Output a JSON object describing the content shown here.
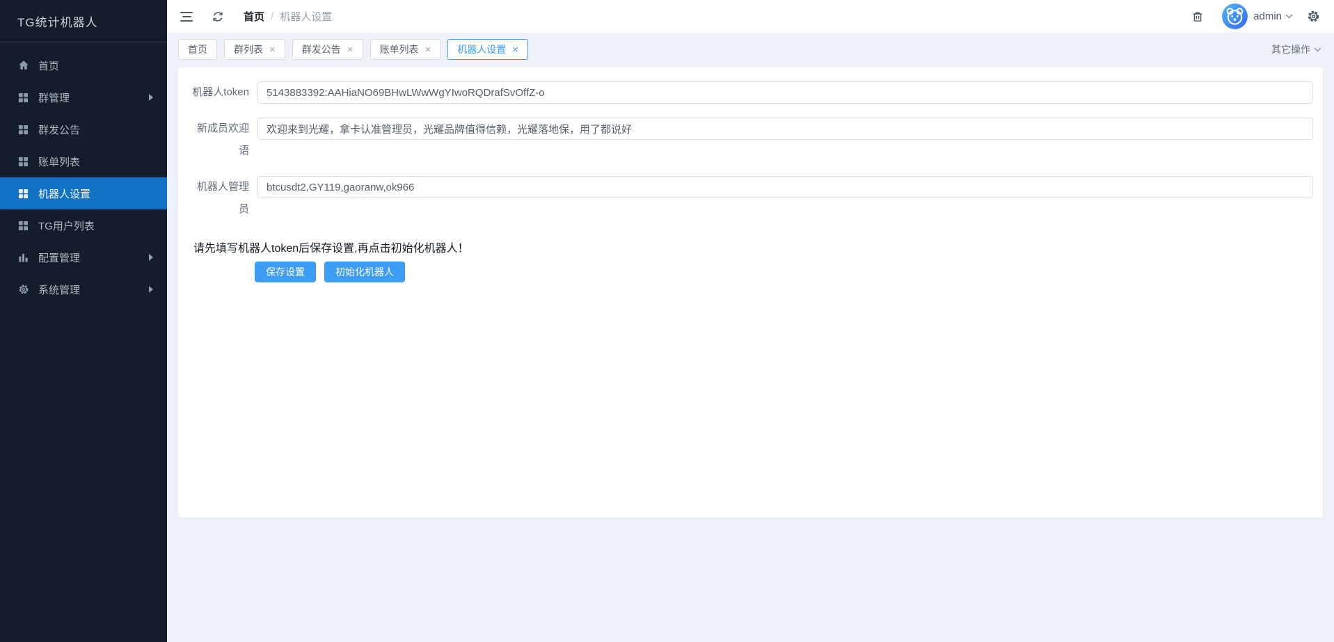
{
  "app": {
    "title": "TG统计机器人"
  },
  "sidebar": {
    "items": [
      {
        "label": "首页",
        "icon": "home-icon",
        "active": false,
        "has_submenu": false
      },
      {
        "label": "群管理",
        "icon": "grid-icon",
        "active": false,
        "has_submenu": true
      },
      {
        "label": "群发公告",
        "icon": "grid-icon",
        "active": false,
        "has_submenu": false
      },
      {
        "label": "账单列表",
        "icon": "grid-icon",
        "active": false,
        "has_submenu": false
      },
      {
        "label": "机器人设置",
        "icon": "grid-icon",
        "active": true,
        "has_submenu": false
      },
      {
        "label": "TG用户列表",
        "icon": "grid-icon",
        "active": false,
        "has_submenu": false
      },
      {
        "label": "配置管理",
        "icon": "chart-icon",
        "active": false,
        "has_submenu": true
      },
      {
        "label": "系统管理",
        "icon": "gear-icon",
        "active": false,
        "has_submenu": true
      }
    ]
  },
  "header": {
    "breadcrumb": {
      "home": "首页",
      "separator": "/",
      "current": "机器人设置"
    },
    "user": "admin"
  },
  "tabs": {
    "items": [
      {
        "label": "首页",
        "closable": false,
        "active": false
      },
      {
        "label": "群列表",
        "closable": true,
        "active": false
      },
      {
        "label": "群发公告",
        "closable": true,
        "active": false
      },
      {
        "label": "账单列表",
        "closable": true,
        "active": false
      },
      {
        "label": "机器人设置",
        "closable": true,
        "active": true
      }
    ],
    "more_label": "其它操作"
  },
  "form": {
    "fields": [
      {
        "label": "机器人token",
        "value": "5143883392:AAHiaNO69BHwLWwWgYIwoRQDrafSvOffZ-o"
      },
      {
        "label": "新成员欢迎语",
        "value": "欢迎来到光耀，拿卡认准管理员，光耀品牌值得信赖，光耀落地保，用了都说好"
      },
      {
        "label": "机器人管理员",
        "value": "btcusdt2,GY119,gaoranw,ok966"
      }
    ],
    "hint": "请先填写机器人token后保存设置,再点击初始化机器人！",
    "buttons": {
      "save": "保存设置",
      "init": "初始化机器人"
    }
  },
  "icons": {
    "close": "×"
  },
  "colors": {
    "sidebar_bg": "#131d2b",
    "menu_active_bg": "#1273c4",
    "primary": "#3d9cf4",
    "page_bg": "#eef1f8",
    "avatar_gradient_start": "#55b2fb",
    "avatar_gradient_end": "#2e6ef2"
  }
}
